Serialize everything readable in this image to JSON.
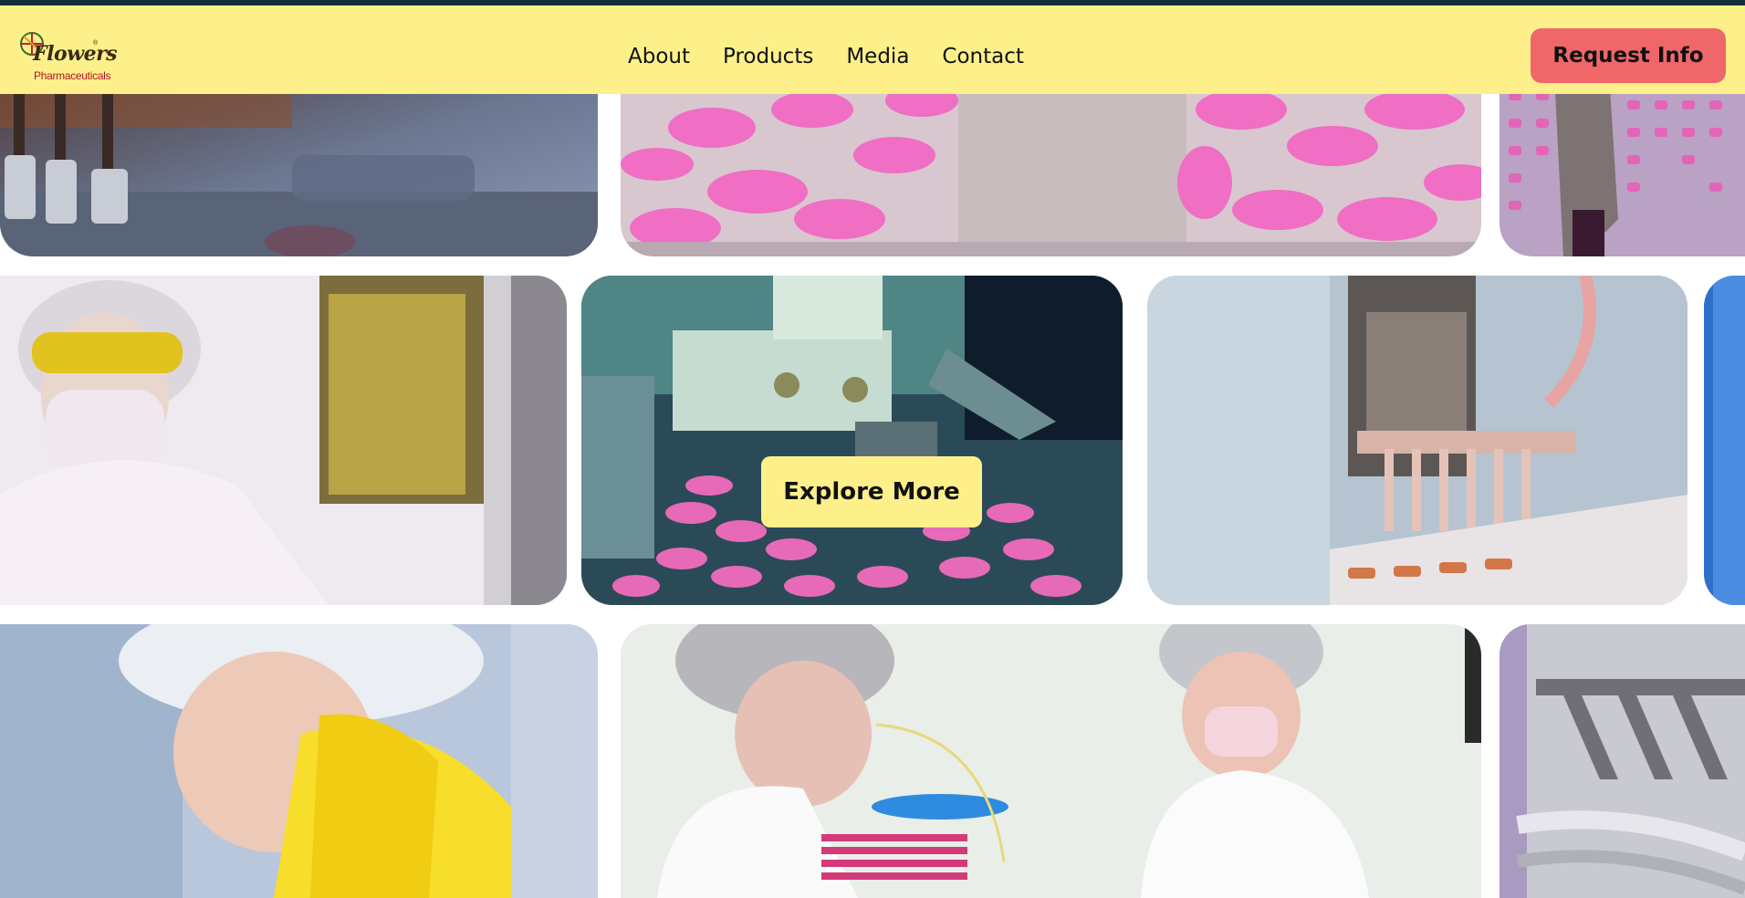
{
  "brand": {
    "logo_word": "Flowers",
    "logo_reg": "®",
    "logo_sub": "Pharmaceuticals"
  },
  "nav": {
    "items": [
      "About",
      "Products",
      "Media",
      "Contact"
    ]
  },
  "header": {
    "cta_label": "Request Info"
  },
  "gallery": {
    "explore_label": "Explore More",
    "tiles": [
      "vial-machine-photo",
      "pink-tablets-photo",
      "blister-pack-photo",
      "worker-goggles-photo",
      "tablet-press-photo",
      "ampoule-filling-photo",
      "blue-edge-photo",
      "worker-yellow-coat-photo",
      "two-workers-photo",
      "steel-machine-photo"
    ]
  },
  "colors": {
    "header_bg": "#fdf08a",
    "cta_bg": "#f0676a",
    "topline": "#12303a"
  }
}
